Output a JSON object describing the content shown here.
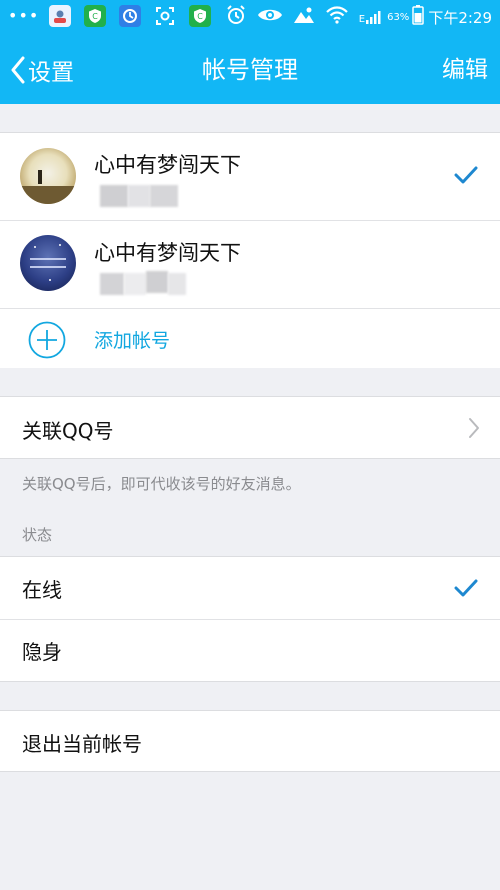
{
  "status_bar": {
    "dots": "•••",
    "network": "E",
    "battery": "63%",
    "time": "下午2:29"
  },
  "nav": {
    "back_label": "设置",
    "title": "帐号管理",
    "edit_label": "编辑"
  },
  "accounts": [
    {
      "name": "心中有梦闯天下",
      "selected": true
    },
    {
      "name": "心中有梦闯天下",
      "selected": false
    }
  ],
  "add_account_label": "添加帐号",
  "link_qq": {
    "label": "关联QQ号",
    "note": "关联QQ号后，即可代收该号的好友消息。"
  },
  "status_section": {
    "header": "状态",
    "options": [
      {
        "label": "在线",
        "selected": true
      },
      {
        "label": "隐身",
        "selected": false
      }
    ]
  },
  "logout_label": "退出当前帐号",
  "colors": {
    "accent": "#12b7f5",
    "check": "#1e88d0",
    "add_icon": "#12a7e0"
  }
}
